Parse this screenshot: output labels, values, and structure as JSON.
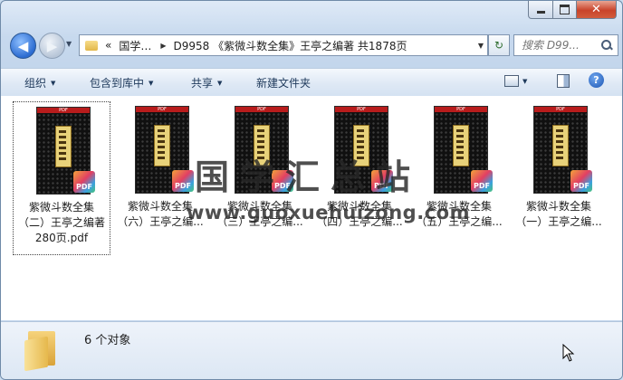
{
  "window": {
    "minimize": "minimize",
    "maximize": "maximize",
    "close": "close"
  },
  "nav": {
    "back_icon": "back-arrow-icon",
    "forward_icon": "forward-arrow-icon",
    "history_icon": "dropdown-icon"
  },
  "address": {
    "overflow": "«",
    "segment1": "国学…",
    "segment2": "D9958 《紫微斗数全集》王亭之编著 共1878页"
  },
  "search": {
    "placeholder": "搜索 D99..."
  },
  "toolbar": {
    "organize": "组织",
    "include_in_library": "包含到库中",
    "share": "共享",
    "new_folder": "新建文件夹",
    "help": "?"
  },
  "files": [
    {
      "name": "紫微斗数全集（二）王亭之编著280页.pdf",
      "selected": true
    },
    {
      "name": "紫微斗数全集（六）王亭之编...",
      "selected": false
    },
    {
      "name": "紫微斗数全集（三）王亭之编...",
      "selected": false
    },
    {
      "name": "紫微斗数全集（四）王亭之编...",
      "selected": false
    },
    {
      "name": "紫微斗数全集（五）王亭之编...",
      "selected": false
    },
    {
      "name": "紫微斗数全集（一）王亭之编...",
      "selected": false
    }
  ],
  "thumb": {
    "header": "PDF",
    "badge": "PDF"
  },
  "watermark": {
    "title": "国学汇总站",
    "url": "www.guoxuehuizong.com"
  },
  "details": {
    "count": "6 个对象"
  }
}
